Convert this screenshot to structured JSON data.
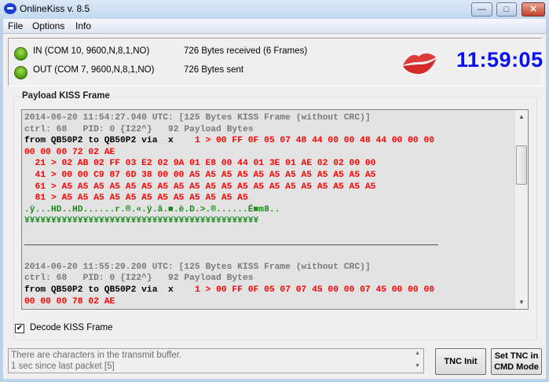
{
  "window": {
    "title": "OnlineKiss v. 8.5",
    "minimize": "—",
    "maximize": "□",
    "close": "✕"
  },
  "menu": [
    "File",
    "Options",
    "Info"
  ],
  "status": {
    "in_port": "IN (COM 10, 9600,N,8,1,NO)",
    "in_bytes": "726 Bytes received (6 Frames)",
    "out_port": "OUT (COM 7, 9600,N,8,1,NO)",
    "out_bytes": "726 Bytes sent",
    "clock": "11:59:05",
    "led_color": "#4a9a10",
    "clock_color": "#0a0ff0"
  },
  "payload": {
    "label": "Payload KISS Frame",
    "frames": [
      {
        "header": "2014-06-20 11:54:27.940 UTC: [125 Bytes KISS Frame (without CRC)]",
        "ctrl": "ctrl: 68   PID: 0 {I22^}   92 Payload Bytes",
        "from": "from QB50P2 to QB50P2 via  x   ",
        "hex": [
          " 1 > 00 FF 0F 05 07 48 44 00 00 48 44 00 00 00",
          "00 00 00 72 02 AE",
          "  21 > 02 AB 02 FF 03 E2 02 9A 01 E8 00 44 01 3E 01 AE 02 02 00 00",
          "  41 > 00 00 C9 87 6D 38 00 00 A5 A5 A5 A5 A5 A5 A5 A5 A5 A5 A5 A5",
          "  61 > A5 A5 A5 A5 A5 A5 A5 A5 A5 A5 A5 A5 A5 A5 A5 A5 A5 A5 A5 A5",
          "  81 > A5 A5 A5 A5 A5 A5 A5 A5 A5 A5 A5 A5"
        ],
        "ascii": ".ÿ...HD..HD......r.®.«.ÿ.â.■.è.D.>.®......É■m8..",
        "yen": "¥¥¥¥¥¥¥¥¥¥¥¥¥¥¥¥¥¥¥¥¥¥¥¥¥¥¥¥¥¥¥¥¥¥¥¥¥¥¥¥¥¥¥¥"
      },
      {
        "header": "2014-06-20 11:55:29.200 UTC: [125 Bytes KISS Frame (without CRC)]",
        "ctrl": "ctrl: 68   PID: 0 {I22^}   92 Payload Bytes",
        "from": "from QB50P2 to QB50P2 via  x   ",
        "hex": [
          " 1 > 00 FF 0F 05 07 07 45 00 00 07 45 00 00 00",
          "00 00 00 78 02 AE"
        ]
      }
    ]
  },
  "decode_checkbox": {
    "label": "Decode KISS Frame",
    "checked": true
  },
  "log": [
    "There are characters in the transmit buffer.",
    "1 sec since last packet [5]"
  ],
  "buttons": {
    "tnc_init": "TNC Init",
    "set_tnc_l1": "Set TNC in",
    "set_tnc_l2": "CMD Mode"
  }
}
